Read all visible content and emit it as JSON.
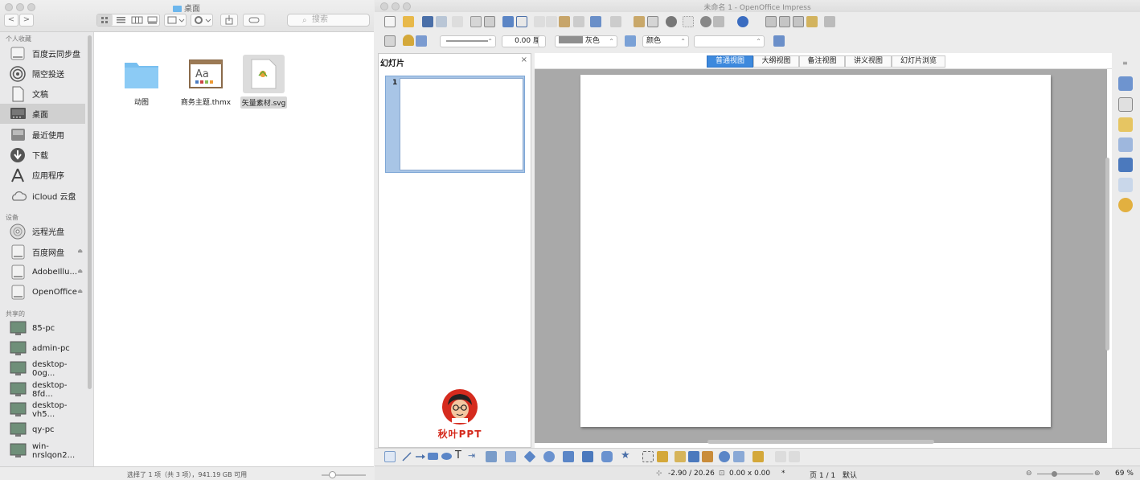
{
  "finder": {
    "title": "桌面",
    "back_label": "<",
    "forward_label": ">",
    "search_placeholder": "搜索",
    "sections": {
      "favorites": "个人收藏",
      "devices": "设备",
      "shared": "共享的"
    },
    "favorites": [
      {
        "label": "百度云同步盘",
        "icon": "drive-icon"
      },
      {
        "label": "隔空投送",
        "icon": "airdrop-icon"
      },
      {
        "label": "文稿",
        "icon": "documents-icon"
      },
      {
        "label": "桌面",
        "icon": "desktop-icon"
      },
      {
        "label": "最近使用",
        "icon": "recents-icon"
      },
      {
        "label": "下载",
        "icon": "downloads-icon"
      },
      {
        "label": "应用程序",
        "icon": "applications-icon"
      },
      {
        "label": "iCloud 云盘",
        "icon": "icloud-icon"
      }
    ],
    "devices": [
      {
        "label": "远程光盘",
        "icon": "disc-icon"
      },
      {
        "label": "百度网盘",
        "icon": "drive-icon"
      },
      {
        "label": "AdobeIllu...",
        "icon": "drive-icon"
      },
      {
        "label": "OpenOffice",
        "icon": "drive-icon"
      }
    ],
    "shared": [
      {
        "label": "85-pc"
      },
      {
        "label": "admin-pc"
      },
      {
        "label": "desktop-0og..."
      },
      {
        "label": "desktop-8fd..."
      },
      {
        "label": "desktop-vh5..."
      },
      {
        "label": "qy-pc"
      },
      {
        "label": "win-nrslqon2..."
      }
    ],
    "files": [
      {
        "name": "动图",
        "icon": "folder-icon"
      },
      {
        "name": "商务主题.thmx",
        "icon": "theme-file-icon"
      },
      {
        "name": "矢量素材.svg",
        "icon": "svg-file-icon"
      }
    ],
    "status": "选择了 1 项（共 3 项），941.19 GB 可用"
  },
  "impress": {
    "title": "未命名 1 - OpenOffice Impress",
    "line_width": "0.00 厘",
    "area_color": "灰色",
    "fill_type": "颜色",
    "slides_pane": {
      "title": "幻灯片",
      "close": "×",
      "slide_number": "1"
    },
    "view_tabs": [
      "普通视图",
      "大纲视图",
      "备注视图",
      "讲义视图",
      "幻灯片浏览"
    ],
    "logo_text": "秋叶PPT",
    "status": {
      "position": "-2.90 / 20.26",
      "size": "0.00 x 0.00",
      "modified": "*",
      "page": "页 1 / 1",
      "layout": "默认",
      "zoom": "69 %"
    }
  },
  "colors": {
    "selection": "#d0d0d0",
    "active_tab": "#3d89dd",
    "folder": "#6cb6ec",
    "canvas_bg": "#a9a9a9",
    "logo_red": "#d52b1e"
  }
}
